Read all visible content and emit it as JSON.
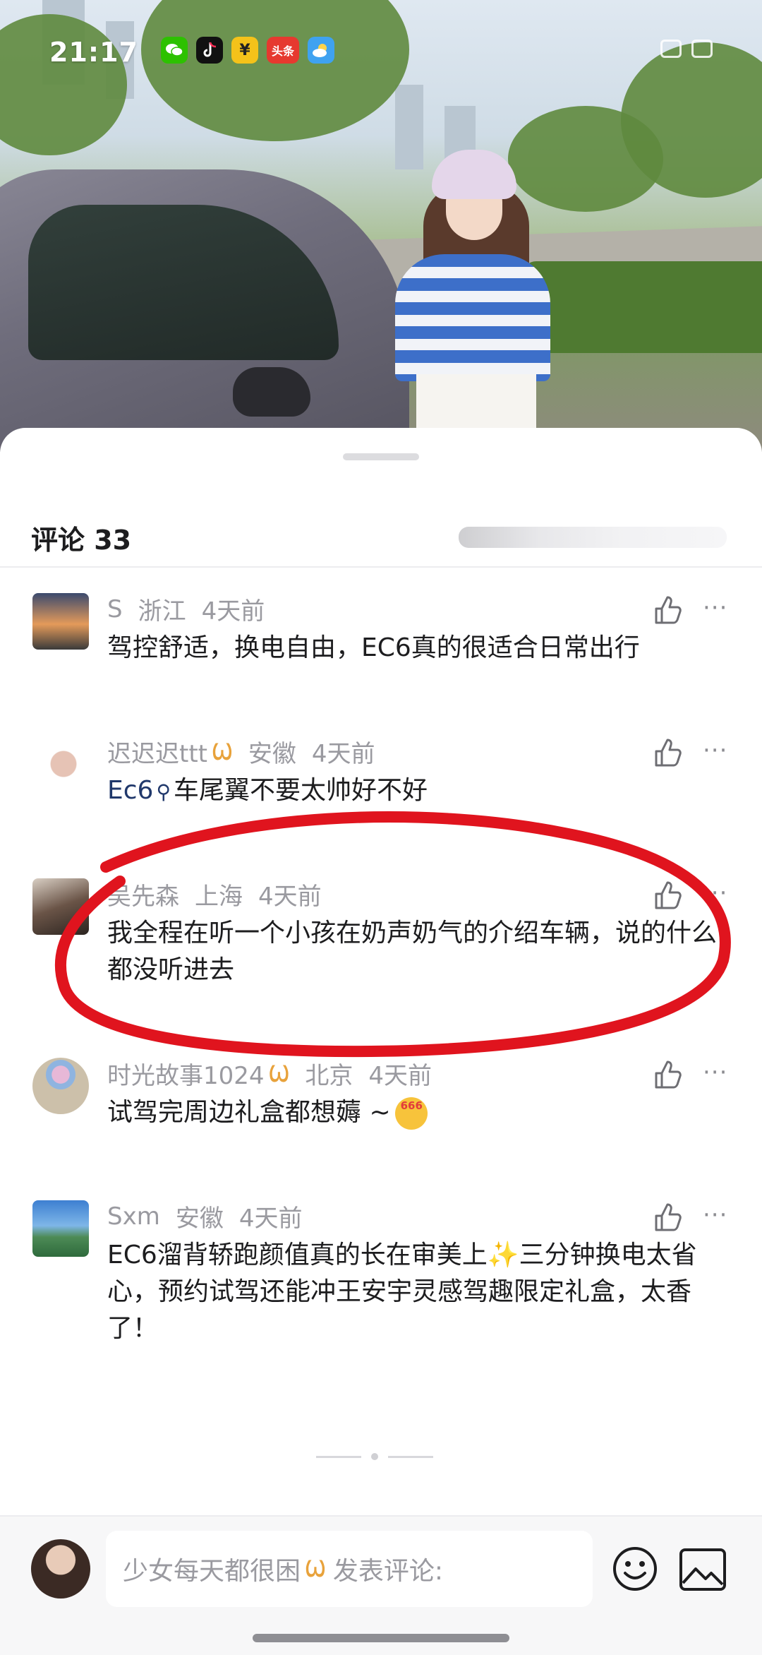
{
  "status_bar": {
    "time": "21:17",
    "apps": [
      {
        "name": "wechat-icon",
        "label": "",
        "color": "#2dc100"
      },
      {
        "name": "tiktok-icon",
        "label": "",
        "color": "#111111"
      },
      {
        "name": "yuan-icon",
        "label": "¥",
        "color": "#f4c21a"
      },
      {
        "name": "toutiao-icon",
        "label": "头条",
        "color": "#e6392f"
      },
      {
        "name": "weather-icon",
        "label": "",
        "color": "#3fa2f0"
      }
    ]
  },
  "comments_header": {
    "title": "评论 33"
  },
  "comments": [
    {
      "author": "S",
      "badge": false,
      "location": "浙江",
      "time": "4天前",
      "text": "驾控舒适，换电自由，EC6真的很适合日常出行"
    },
    {
      "author": "迟迟迟ttt",
      "badge": true,
      "location": "安徽",
      "time": "4天前",
      "link": "Ec6",
      "text": "车尾翼不要太帅好不好"
    },
    {
      "author": "吴先森",
      "badge": false,
      "location": "上海",
      "time": "4天前",
      "text": "我全程在听一个小孩在奶声奶气的介绍车辆，说的什么都没听进去"
    },
    {
      "author": "时光故事1024",
      "badge": true,
      "location": "北京",
      "time": "4天前",
      "text": "试驾完周边礼盒都想薅 ~"
    },
    {
      "author": "Sxm",
      "badge": false,
      "location": "安徽",
      "time": "4天前",
      "text_a": "EC6溜背轿跑颜值真的长在审美上",
      "text_b": "三分钟换电太省心，预约试驾还能冲王安宇灵感驾趣限定礼盒，太香了！"
    }
  ],
  "input": {
    "placeholder_user": "少女每天都很困",
    "placeholder_suffix": "发表评论:"
  },
  "colors": {
    "accent_red": "#e0141e",
    "badge_gold": "#e8a23b",
    "link_blue": "#20386b"
  }
}
